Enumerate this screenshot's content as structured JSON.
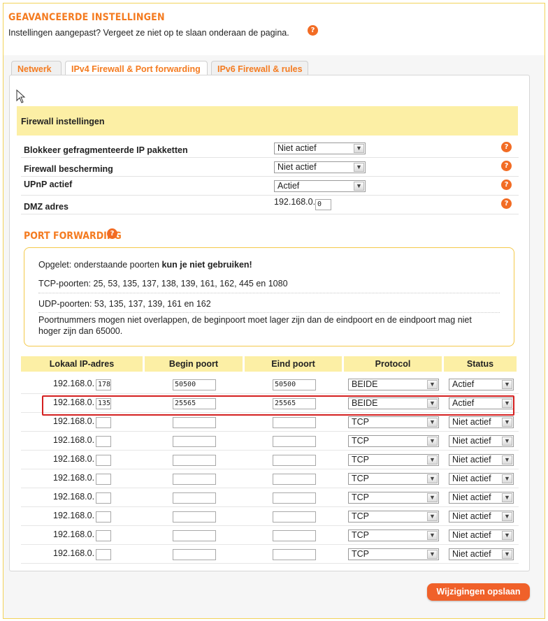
{
  "page": {
    "heading": "GEAVANCEERDE INSTELLINGEN",
    "subtitle": "Instellingen aangepast? Vergeet ze niet op te slaan onderaan de pagina."
  },
  "help_glyph": "?",
  "tabs": [
    {
      "label": "Netwerk",
      "active": false
    },
    {
      "label": "IPv4 Firewall & Port forwarding",
      "active": true
    },
    {
      "label": "IPv6 Firewall & rules",
      "active": false
    }
  ],
  "firewall": {
    "section_title": "Firewall instellingen",
    "rows": [
      {
        "label": "Blokkeer gefragmenteerde IP pakketten",
        "value": "Niet actief"
      },
      {
        "label": "Firewall bescherming",
        "value": "Niet actief"
      },
      {
        "label": "UPnP actief",
        "value": "Actief"
      }
    ],
    "dmz": {
      "label": "DMZ adres",
      "prefix": "192.168.0.",
      "value": "0"
    }
  },
  "port_forwarding": {
    "title": "PORT FORWARDING",
    "notice": {
      "warning_prefix": "Opgelet: onderstaande poorten ",
      "warning_bold": "kun je niet gebruiken!",
      "tcp": "TCP-poorten: 25, 53, 135, 137, 138, 139, 161, 162, 445 en 1080",
      "udp": "UDP-poorten: 53, 135, 137, 139, 161 en 162",
      "rule_line1": "Poortnummers mogen niet overlappen, de beginpoort moet lager zijn dan de eindpoort en de eindpoort mag niet",
      "rule_line2": "hoger zijn dan 65000."
    },
    "columns": [
      "Lokaal IP-adres",
      "Begin poort",
      "Eind poort",
      "Protocol",
      "Status"
    ],
    "ip_prefix": "192.168.0.",
    "rows": [
      {
        "ip_suffix": "178",
        "begin": "50500",
        "end": "50500",
        "protocol": "BEIDE",
        "status": "Actief"
      },
      {
        "ip_suffix": "135",
        "begin": "25565",
        "end": "25565",
        "protocol": "BEIDE",
        "status": "Actief"
      },
      {
        "ip_suffix": "",
        "begin": "",
        "end": "",
        "protocol": "TCP",
        "status": "Niet actief"
      },
      {
        "ip_suffix": "",
        "begin": "",
        "end": "",
        "protocol": "TCP",
        "status": "Niet actief"
      },
      {
        "ip_suffix": "",
        "begin": "",
        "end": "",
        "protocol": "TCP",
        "status": "Niet actief"
      },
      {
        "ip_suffix": "",
        "begin": "",
        "end": "",
        "protocol": "TCP",
        "status": "Niet actief"
      },
      {
        "ip_suffix": "",
        "begin": "",
        "end": "",
        "protocol": "TCP",
        "status": "Niet actief"
      },
      {
        "ip_suffix": "",
        "begin": "",
        "end": "",
        "protocol": "TCP",
        "status": "Niet actief"
      },
      {
        "ip_suffix": "",
        "begin": "",
        "end": "",
        "protocol": "TCP",
        "status": "Niet actief"
      },
      {
        "ip_suffix": "",
        "begin": "",
        "end": "",
        "protocol": "TCP",
        "status": "Niet actief"
      }
    ]
  },
  "save_button": "Wijzigingen opslaan",
  "colors": {
    "accent": "#f47b20",
    "button": "#f0612a",
    "header_band": "#fcefa5",
    "highlight": "#d42020"
  }
}
